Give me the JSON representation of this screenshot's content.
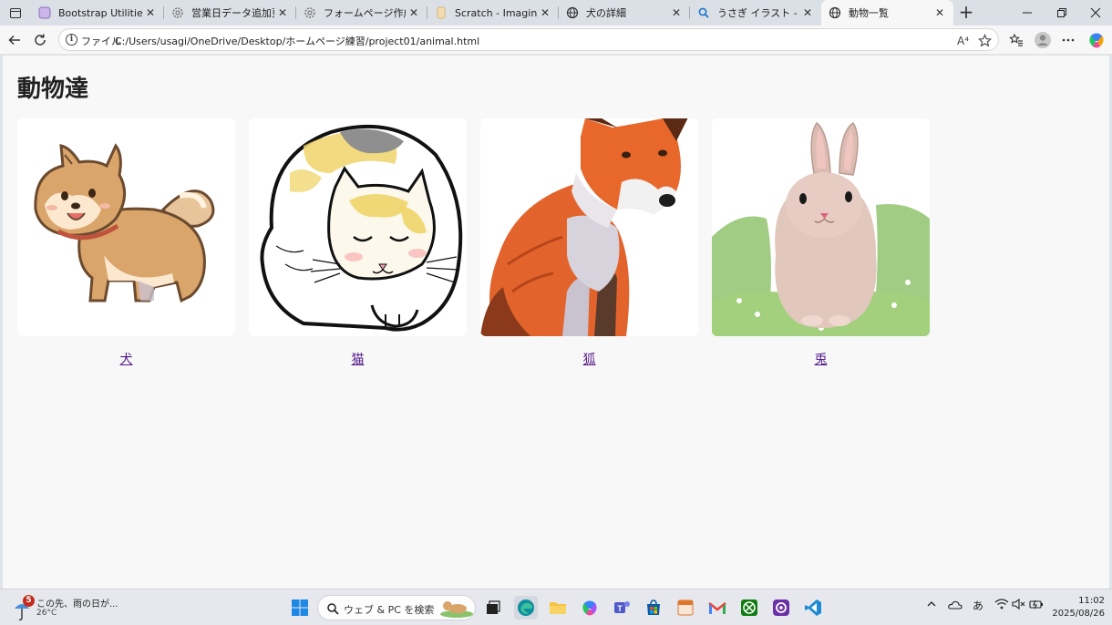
{
  "tabs": [
    {
      "title": "Bootstrap Utilities Cheat",
      "icon": "bootstrap-icon"
    },
    {
      "title": "営業日データ追加更新",
      "icon": "gear-icon"
    },
    {
      "title": "フォームページ作成方法",
      "icon": "gear-icon"
    },
    {
      "title": "Scratch - Imagine, Program",
      "icon": "scratch-icon"
    },
    {
      "title": "犬の詳細",
      "icon": "globe-icon"
    },
    {
      "title": "うさぎ イラスト - 検索 画像",
      "icon": "search-icon"
    },
    {
      "title": "動物一覧",
      "icon": "globe-icon"
    }
  ],
  "address": {
    "file_label": "ファイル",
    "url": "C:/Users/usagi/OneDrive/Desktop/ホームページ練習/project01/animal.html",
    "read_aloud_label": "A⁴"
  },
  "page": {
    "heading": "動物達",
    "animals": [
      {
        "label": "犬",
        "image": "shiba-dog-illustration"
      },
      {
        "label": "猫",
        "image": "calico-cat-illustration"
      },
      {
        "label": "狐",
        "image": "red-fox-watercolor"
      },
      {
        "label": "兎",
        "image": "rabbit-illustration"
      }
    ]
  },
  "taskbar": {
    "weather_badge": "5",
    "weather_text": "この先、雨の日が...",
    "temperature": "26°C",
    "search_placeholder": "ウェブ & PC を検索",
    "ime_label": "あ",
    "time": "11:02",
    "date": "2025/08/26"
  },
  "colors": {
    "link": "#551a8b",
    "page_background": "#f8f8f8",
    "tab_strip": "#dbdfe6"
  }
}
